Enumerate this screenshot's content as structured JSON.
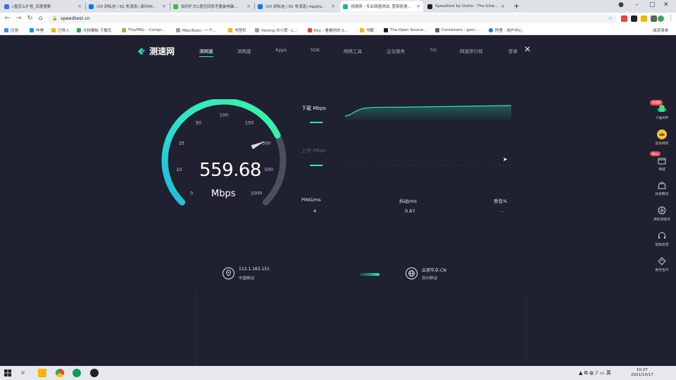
{
  "browser": {
    "tabs": [
      {
        "title": "c盘怎么扩容_百度搜索",
        "favicon_color": "#3b6ff2",
        "active": false
      },
      {
        "title": "(20 封私信 / 82 条消息) 请问Wi...",
        "favicon_color": "#1772f6",
        "active": false
      },
      {
        "title": "如何扩大C盘空间而不重装电脑...",
        "favicon_color": "#4caf50",
        "active": false
      },
      {
        "title": "(20 封私信 / 82 条消息) AppDa...",
        "favicon_color": "#1772f6",
        "active": false
      },
      {
        "title": "测速网 - 专业网速测试, 宽带提速...",
        "favicon_color": "#22b39a",
        "active": true
      },
      {
        "title": "Speedtest by Ookla - The Glob...",
        "favicon_color": "#202124",
        "active": false
      }
    ],
    "new_tab": "+",
    "url": "speedtest.cn",
    "bookmarks": [
      {
        "label": "应用",
        "color": "#4285f4"
      },
      {
        "label": "哔哩",
        "color": "#00a1d6"
      },
      {
        "label": "已导入",
        "color": "#f4b400"
      },
      {
        "label": "文档模板 下载页",
        "color": "#34a853"
      },
      {
        "label": "TinyPNG – Compr...",
        "color": "#8bc34a"
      },
      {
        "label": "MikuTools - 一个...",
        "color": "#9e9e9e"
      },
      {
        "label": "书签栏",
        "color": "#f4b400"
      },
      {
        "label": "Verong の小窝 - L...",
        "color": "#9e9e9e"
      },
      {
        "label": "Key - 看看你的 S...",
        "color": "#ea4335"
      },
      {
        "label": "书籍",
        "color": "#f4b400"
      },
      {
        "label": "The Open Source...",
        "color": "#202124"
      },
      {
        "label": "Containers - goor...",
        "color": "#5f6368"
      },
      {
        "label": "阿里 - 用户中心",
        "color": "#1a73e8"
      }
    ],
    "reading_list": "阅读清单"
  },
  "site": {
    "logo_text": "测速网",
    "nav": [
      {
        "label": "测网速",
        "active": true
      },
      {
        "label": "测网速",
        "active": false
      },
      {
        "label": "Apps",
        "active": false
      },
      {
        "label": "SDK",
        "active": false
      },
      {
        "label": "网络工具",
        "active": false
      },
      {
        "label": "企业服务",
        "active": false
      },
      {
        "label": "5G",
        "active": false
      },
      {
        "label": "网速排行榜",
        "active": false
      },
      {
        "label": "登录",
        "active": false
      }
    ],
    "close": "✕"
  },
  "gauge": {
    "ticks": [
      "0",
      "10",
      "25",
      "50",
      "100",
      "150",
      "300",
      "500",
      "1000"
    ],
    "speed": "559.68",
    "unit": "Mbps",
    "fraction": 0.74
  },
  "panel": {
    "download_label": "下载 Mbps",
    "upload_label": "上传 Mbps",
    "stats": [
      {
        "label": "PING/ms",
        "value": "4"
      },
      {
        "label": "抖动/ms",
        "value": "0.67"
      },
      {
        "label": "丢包%",
        "value": "-"
      }
    ]
  },
  "client": {
    "ip": "112.1.163.151",
    "isp": "中国移动"
  },
  "server": {
    "name": "云测节点-CN",
    "isp": "苏州移动"
  },
  "sidebar": [
    {
      "label": "下载APP",
      "badge": "新速版",
      "icon": "android-icon"
    },
    {
      "label": "会员特权",
      "badge": "",
      "icon": "crown-icon"
    },
    {
      "label": "商城",
      "badge": "New",
      "icon": "shop-icon"
    },
    {
      "label": "抗拒腾讯",
      "badge": "",
      "icon": "bag-icon"
    },
    {
      "label": "添加测速点",
      "badge": "",
      "icon": "network-icon"
    },
    {
      "label": "帮助反馈",
      "badge": "",
      "icon": "headset-icon"
    },
    {
      "label": "商务合作",
      "badge": "",
      "icon": "handshake-icon"
    }
  ],
  "taskbar": {
    "time": "10:27",
    "date": "2021/10/17"
  }
}
